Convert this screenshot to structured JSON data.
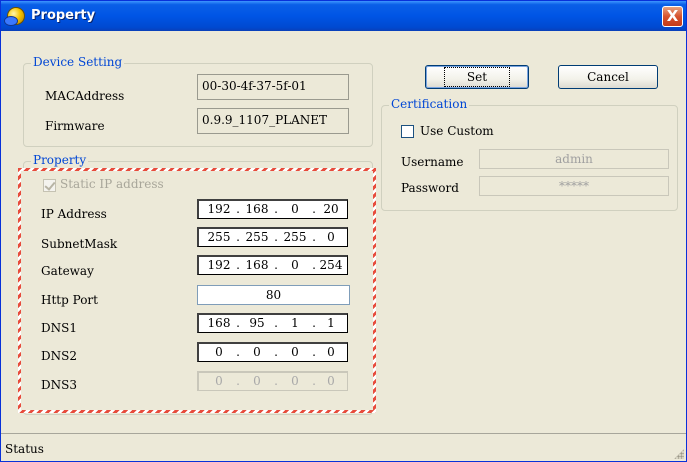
{
  "window": {
    "title": "Property",
    "close_label": "X"
  },
  "device_setting": {
    "legend": "Device Setting",
    "mac_label": "MACAddress",
    "mac_value": "00-30-4f-37-5f-01",
    "firmware_label": "Firmware",
    "firmware_value": "0.9.9_1107_PLANET"
  },
  "property": {
    "legend": "Property",
    "static_ip_label": "Static IP address",
    "static_ip_checked": true,
    "ip_label": "IP Address",
    "ip": [
      "192",
      "168",
      "0",
      "20"
    ],
    "subnet_label": "SubnetMask",
    "subnet": [
      "255",
      "255",
      "255",
      "0"
    ],
    "gateway_label": "Gateway",
    "gateway": [
      "192",
      "168",
      "0",
      "254"
    ],
    "http_port_label": "Http Port",
    "http_port": "80",
    "dns1_label": "DNS1",
    "dns1": [
      "168",
      "95",
      "1",
      "1"
    ],
    "dns2_label": "DNS2",
    "dns2": [
      "0",
      "0",
      "0",
      "0"
    ],
    "dns3_label": "DNS3",
    "dns3": [
      "0",
      "0",
      "0",
      "0"
    ]
  },
  "buttons": {
    "set": "Set",
    "cancel": "Cancel"
  },
  "certification": {
    "legend": "Certification",
    "use_custom_label": "Use Custom",
    "use_custom_checked": false,
    "username_label": "Username",
    "username_value": "admin",
    "password_label": "Password",
    "password_value": "*****"
  },
  "status": {
    "text": "Status"
  },
  "colors": {
    "title_bar": "#0055e5",
    "legend_text": "#0046d5",
    "highlight_hatch": "#e74c3c",
    "dialog_bg": "#ece9d8"
  }
}
